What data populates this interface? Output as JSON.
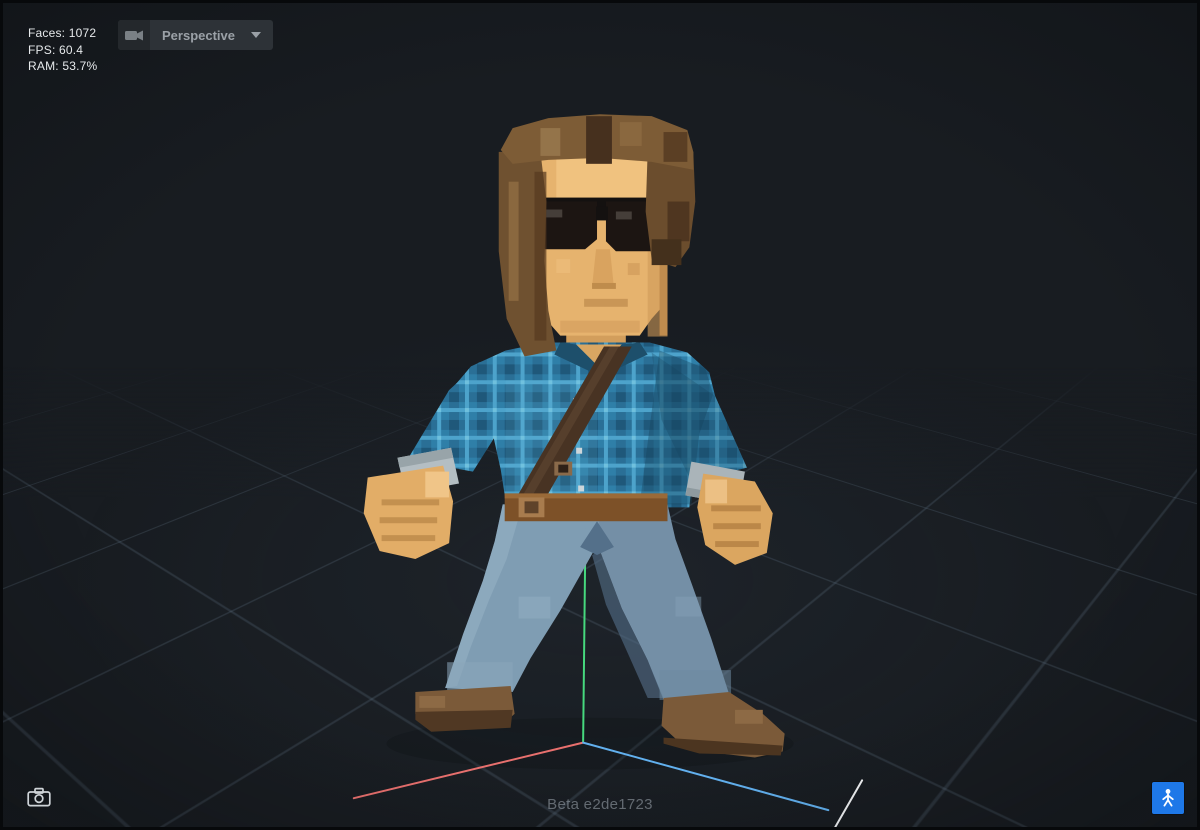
{
  "hud": {
    "stats": {
      "faces": "Faces: 1072",
      "fps": "FPS: 60.4",
      "ram": "RAM: 53.7%"
    },
    "camera_mode": {
      "label": "Perspective"
    },
    "watermark": "Beta e2de1723"
  },
  "colors": {
    "axis_x": "#e8706e",
    "axis_y": "#46d97e",
    "axis_z": "#62b0ee",
    "axis_white": "#f2f4f6",
    "accent_blue": "#1e78e8"
  },
  "icons": {
    "perspective_camera": "video-camera",
    "dropdown_caret": "chevron-down",
    "screenshot": "camera",
    "pose_tool": "stick-figure"
  }
}
